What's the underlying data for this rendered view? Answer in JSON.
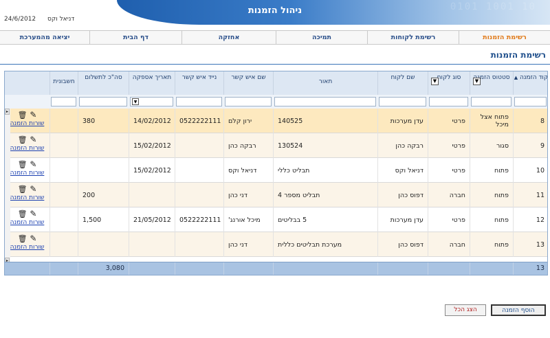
{
  "app": {
    "title": "ניהול הזמנות",
    "date": "24/6/2012",
    "user": "דניאל וקס"
  },
  "nav": {
    "items": [
      {
        "label": "רשימת הזמנות",
        "active": true
      },
      {
        "label": "רשימת לקוחות"
      },
      {
        "label": "תמיכה"
      },
      {
        "label": "אחזקה"
      },
      {
        "label": "דף הבית"
      },
      {
        "label": "יציאה מהמערכת"
      }
    ]
  },
  "page": {
    "title": "רשימת הזמנות"
  },
  "grid": {
    "columns": [
      {
        "label": "קוד הזמנה",
        "sort_arrow": "▲"
      },
      {
        "label": "סטטוס הזמנה"
      },
      {
        "label": "סוג לקוח"
      },
      {
        "label": "שם לקוח"
      },
      {
        "label": "תאור"
      },
      {
        "label": "שם איש קשר"
      },
      {
        "label": "נייד איש קשר"
      },
      {
        "label": "תאריך אספקה"
      },
      {
        "label": "סה\"כ לתשלום"
      },
      {
        "label": "חשבונית"
      }
    ],
    "rows": [
      {
        "code": "8",
        "status": "פתוח אצל מיכל",
        "ctype": "פרטי",
        "cname": "עדן מערכות",
        "desc": "140525",
        "contact": "ירון קלם",
        "mobile": "0522222111",
        "date": "14/02/2012",
        "total": "380",
        "invoice": "",
        "link": "שורות הזמנה"
      },
      {
        "code": "9",
        "status": "סגור",
        "ctype": "פרטי",
        "cname": "רבקה כהן",
        "desc": "130524",
        "contact": "רבקה כהן",
        "mobile": "",
        "date": "15/02/2012",
        "total": "",
        "invoice": "",
        "link": "שורות הזמנה"
      },
      {
        "code": "10",
        "status": "פתוח",
        "ctype": "פרטי",
        "cname": "דניאל וקס",
        "desc": "תבליט כללי",
        "contact": "דניאל וקס",
        "mobile": "",
        "date": "15/02/2012",
        "total": "",
        "invoice": "",
        "link": "שורות הזמנה"
      },
      {
        "code": "11",
        "status": "פתוח",
        "ctype": "חברה",
        "cname": "דפוס כהן",
        "desc": "תבליט מספר 4",
        "contact": "דני כהן",
        "mobile": "",
        "date": "",
        "total": "200",
        "invoice": "",
        "link": "שורות הזמנה"
      },
      {
        "code": "12",
        "status": "פתוח",
        "ctype": "פרטי",
        "cname": "עדן מערכות",
        "desc": "5 בבליטים",
        "contact": "מיכל אורנג'",
        "mobile": "0522222111",
        "date": "21/05/2012",
        "total": "1,500",
        "invoice": "",
        "link": "שורות הזמנה"
      },
      {
        "code": "13",
        "status": "פתוח",
        "ctype": "חברה",
        "cname": "דפוס כהן",
        "desc": "מערכת תבליטים כללית",
        "contact": "דני כהן",
        "mobile": "",
        "date": "",
        "total": "",
        "invoice": "",
        "link": "שורות הזמנה"
      }
    ],
    "footer": {
      "count": "13",
      "total": "3,080"
    }
  },
  "buttons": {
    "add_order": "הוסף הזמנה",
    "show_all": "הצג הכל"
  }
}
